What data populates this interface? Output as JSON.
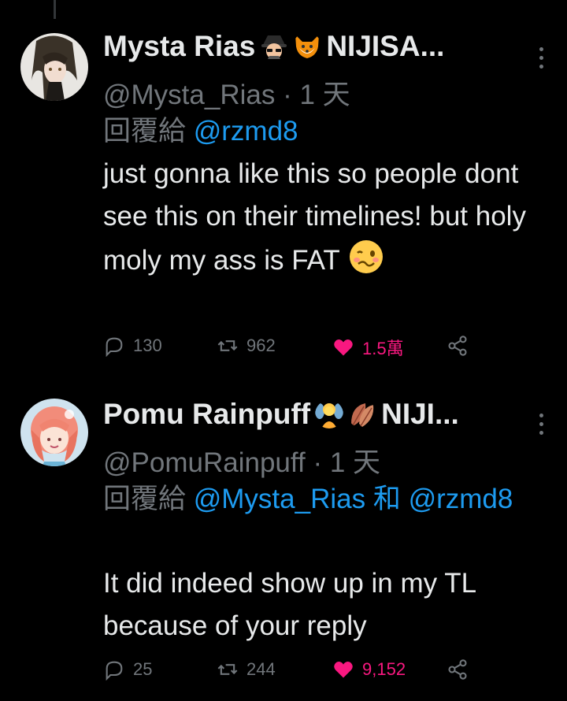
{
  "tweets": [
    {
      "display_name": "Mysta Rias",
      "name_suffix": "NIJISA...",
      "name_emojis": [
        "detective-emoji",
        "fox-emoji"
      ],
      "handle": "@Mysta_Rias",
      "separator": "·",
      "time": "1 天",
      "reply_prefix": "回覆給",
      "reply_mentions": [
        "@rzmd8"
      ],
      "reply_joiner": "",
      "text": "just gonna like this so people dont see this on their timelines! but holy moly my ass is FAT",
      "text_emoji": "woozy-face-emoji",
      "replies": "130",
      "retweets": "962",
      "likes": "1.5萬",
      "liked": true
    },
    {
      "display_name": "Pomu Rainpuff",
      "name_suffix": "NIJI...",
      "name_emojis": [
        "fairy-emoji",
        "leaf-emoji"
      ],
      "handle": "@PomuRainpuff",
      "separator": "·",
      "time": "1 天",
      "reply_prefix": "回覆給",
      "reply_mentions": [
        "@Mysta_Rias",
        "@rzmd8"
      ],
      "reply_joiner": "和",
      "text": "It did indeed show up in my TL because of your reply",
      "replies": "25",
      "retweets": "244",
      "likes": "9,152",
      "liked": true
    }
  ],
  "colors": {
    "background": "#000000",
    "text": "#e7e9ea",
    "muted": "#71767b",
    "link": "#1d9bf0",
    "like": "#f91880"
  }
}
